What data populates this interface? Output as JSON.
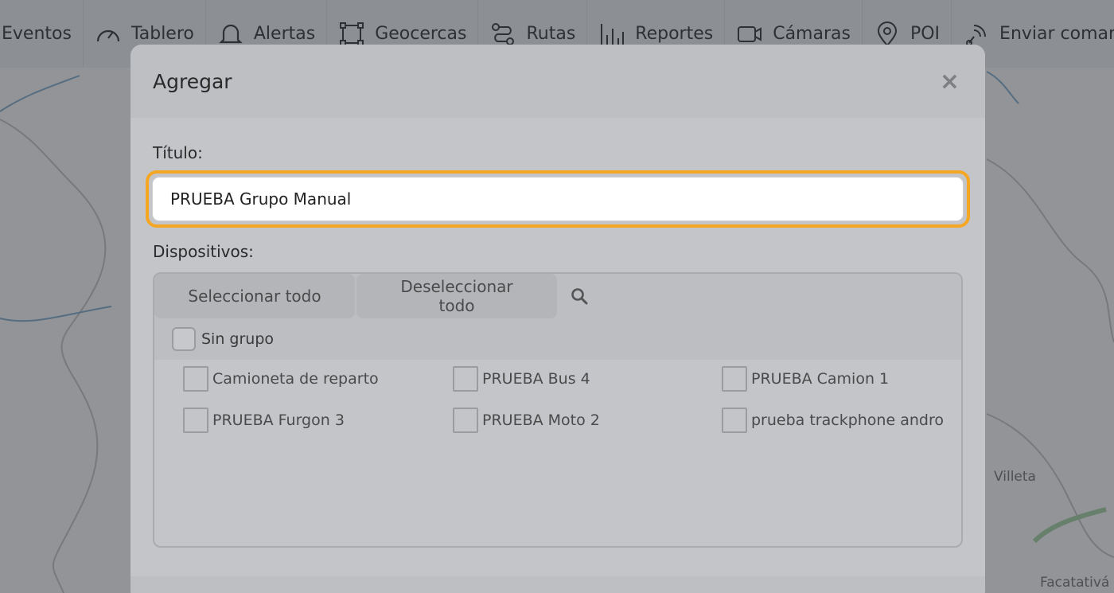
{
  "nav": {
    "items": [
      {
        "label": "Eventos",
        "icon": "bell-events-icon"
      },
      {
        "label": "Tablero",
        "icon": "speedometer-icon"
      },
      {
        "label": "Alertas",
        "icon": "bell-icon"
      },
      {
        "label": "Geocercas",
        "icon": "geofence-icon"
      },
      {
        "label": "Rutas",
        "icon": "route-icon"
      },
      {
        "label": "Reportes",
        "icon": "bar-chart-icon"
      },
      {
        "label": "Cámaras",
        "icon": "camera-icon"
      },
      {
        "label": "POI",
        "icon": "map-pin-icon"
      },
      {
        "label": "Enviar comando",
        "icon": "signal-icon"
      }
    ]
  },
  "map": {
    "labels": {
      "villeta": "Villeta",
      "facatativa": "Facatativá"
    }
  },
  "modal": {
    "title": "Agregar",
    "close_glyph": "×",
    "title_field": {
      "label": "Título:",
      "value": "PRUEBA Grupo Manual"
    },
    "devices": {
      "label": "Dispositivos:",
      "select_all": "Seleccionar todo",
      "deselect_all": "Deseleccionar todo",
      "group": {
        "label": "Sin grupo"
      },
      "items": [
        {
          "label": "Camioneta de reparto"
        },
        {
          "label": "PRUEBA Bus 4"
        },
        {
          "label": "PRUEBA Camion 1"
        },
        {
          "label": "PRUEBA Furgon 3"
        },
        {
          "label": "PRUEBA Moto 2"
        },
        {
          "label": "prueba trackphone andro"
        }
      ]
    }
  },
  "colors": {
    "accent_focus": "#f5a623"
  }
}
